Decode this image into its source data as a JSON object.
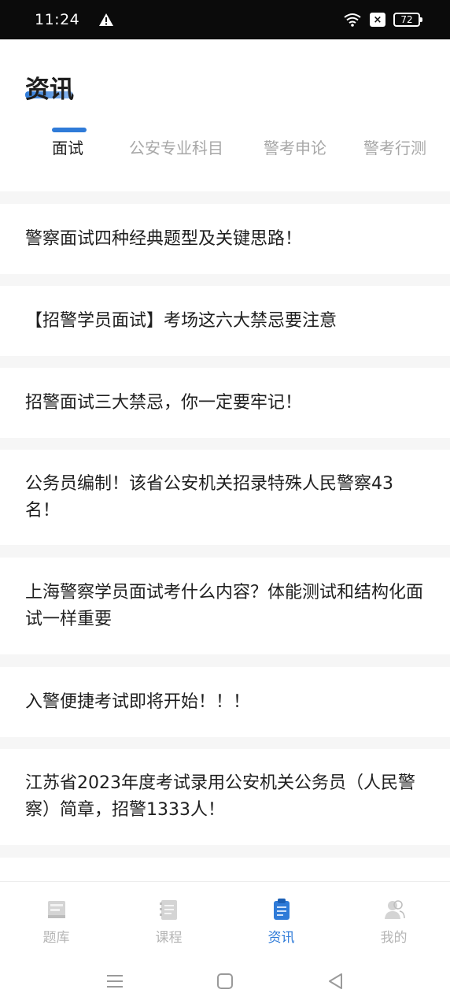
{
  "status_bar": {
    "time": "11:24",
    "battery": "72",
    "x_badge": "×"
  },
  "header": {
    "title": "资讯",
    "tabs": [
      {
        "label": "面试"
      },
      {
        "label": "公安专业科目"
      },
      {
        "label": "警考申论"
      },
      {
        "label": "警考行测"
      }
    ],
    "active_tab": 0
  },
  "news": [
    {
      "title": "警察面试四种经典题型及关键思路！"
    },
    {
      "title": "【招警学员面试】考场这六大禁忌要注意"
    },
    {
      "title": "招警面试三大禁忌，你一定要牢记！"
    },
    {
      "title": "公务员编制！该省公安机关招录特殊人民警察43名！"
    },
    {
      "title": "上海警察学员面试考什么内容？体能测试和结构化面试一样重要"
    },
    {
      "title": "入警便捷考试即将开始！！！"
    },
    {
      "title": "江苏省2023年度考试录用公安机关公务员（人民警察）简章，招警1333人！"
    }
  ],
  "bottom_nav": [
    {
      "label": "题库",
      "icon": "question-bank-icon"
    },
    {
      "label": "课程",
      "icon": "course-icon"
    },
    {
      "label": "资讯",
      "icon": "news-icon"
    },
    {
      "label": "我的",
      "icon": "profile-icon"
    }
  ],
  "active_nav": 2,
  "colors": {
    "accent": "#2f7bd8",
    "inactive": "#b5b5b5",
    "text": "#1f1f1f"
  }
}
